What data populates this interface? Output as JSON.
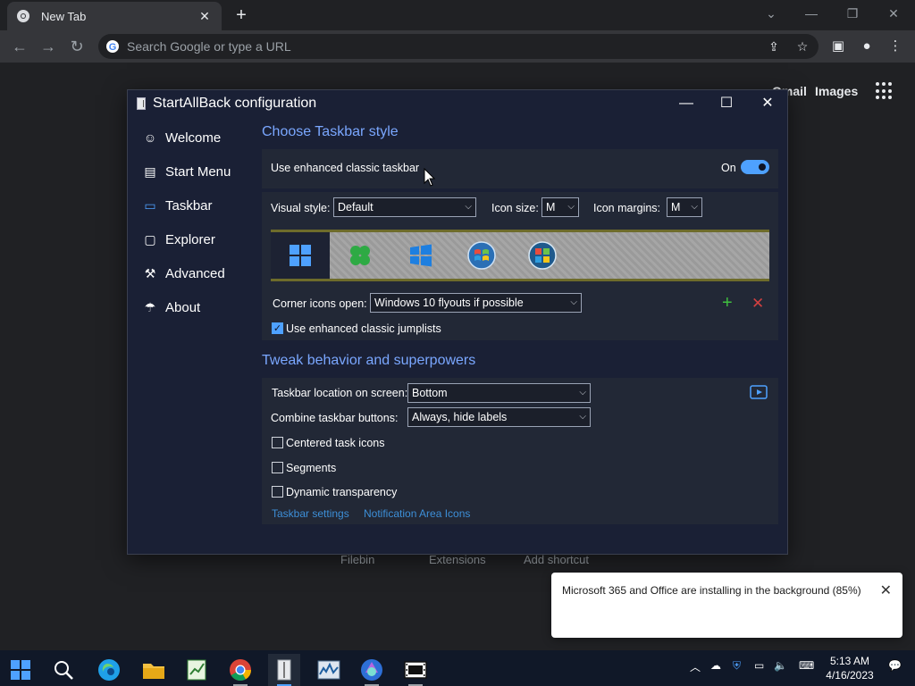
{
  "browser": {
    "tab_title": "New Tab",
    "omnibox_placeholder": "Search Google or type a URL",
    "gmail_link": "Gmail",
    "images_link": "Images",
    "shortcuts": [
      "Filebin",
      "Extensions",
      "Add shortcut"
    ]
  },
  "dialog": {
    "title": "StartAllBack configuration",
    "nav": [
      {
        "label": "Welcome",
        "icon": "smile-icon"
      },
      {
        "label": "Start Menu",
        "icon": "start-menu-icon"
      },
      {
        "label": "Taskbar",
        "icon": "taskbar-icon",
        "active": true
      },
      {
        "label": "Explorer",
        "icon": "folder-icon"
      },
      {
        "label": "Advanced",
        "icon": "wrench-icon"
      },
      {
        "label": "About",
        "icon": "info-icon"
      }
    ],
    "section1_title": "Choose Taskbar style",
    "enhanced_taskbar_label": "Use enhanced classic taskbar",
    "toggle_state": "On",
    "visual_style_label": "Visual style:",
    "visual_style_value": "Default",
    "icon_size_label": "Icon size:",
    "icon_size_value": "M",
    "icon_margins_label": "Icon margins:",
    "icon_margins_value": "M",
    "corner_icons_label": "Corner icons open:",
    "corner_icons_value": "Windows 10 flyouts if possible",
    "jumplists_label": "Use enhanced classic jumplists",
    "section2_title": "Tweak behavior and superpowers",
    "location_label": "Taskbar location on screen:",
    "location_value": "Bottom",
    "combine_label": "Combine taskbar buttons:",
    "combine_value": "Always, hide labels",
    "centered_label": "Centered task icons",
    "segments_label": "Segments",
    "dynamic_label": "Dynamic transparency",
    "link_taskbar_settings": "Taskbar settings",
    "link_notification_icons": "Notification Area Icons"
  },
  "toast": {
    "text": "Microsoft 365 and Office are installing in the background (85%)",
    "progress_percent": 85
  },
  "taskbar": {
    "time": "5:13 AM",
    "date": "4/16/2023"
  },
  "colors": {
    "accent": "#4ea1ff",
    "section_title": "#7aa7ff",
    "link": "#3d8fd8",
    "add_icon": "#3fbf3f",
    "remove_icon": "#d04040"
  }
}
